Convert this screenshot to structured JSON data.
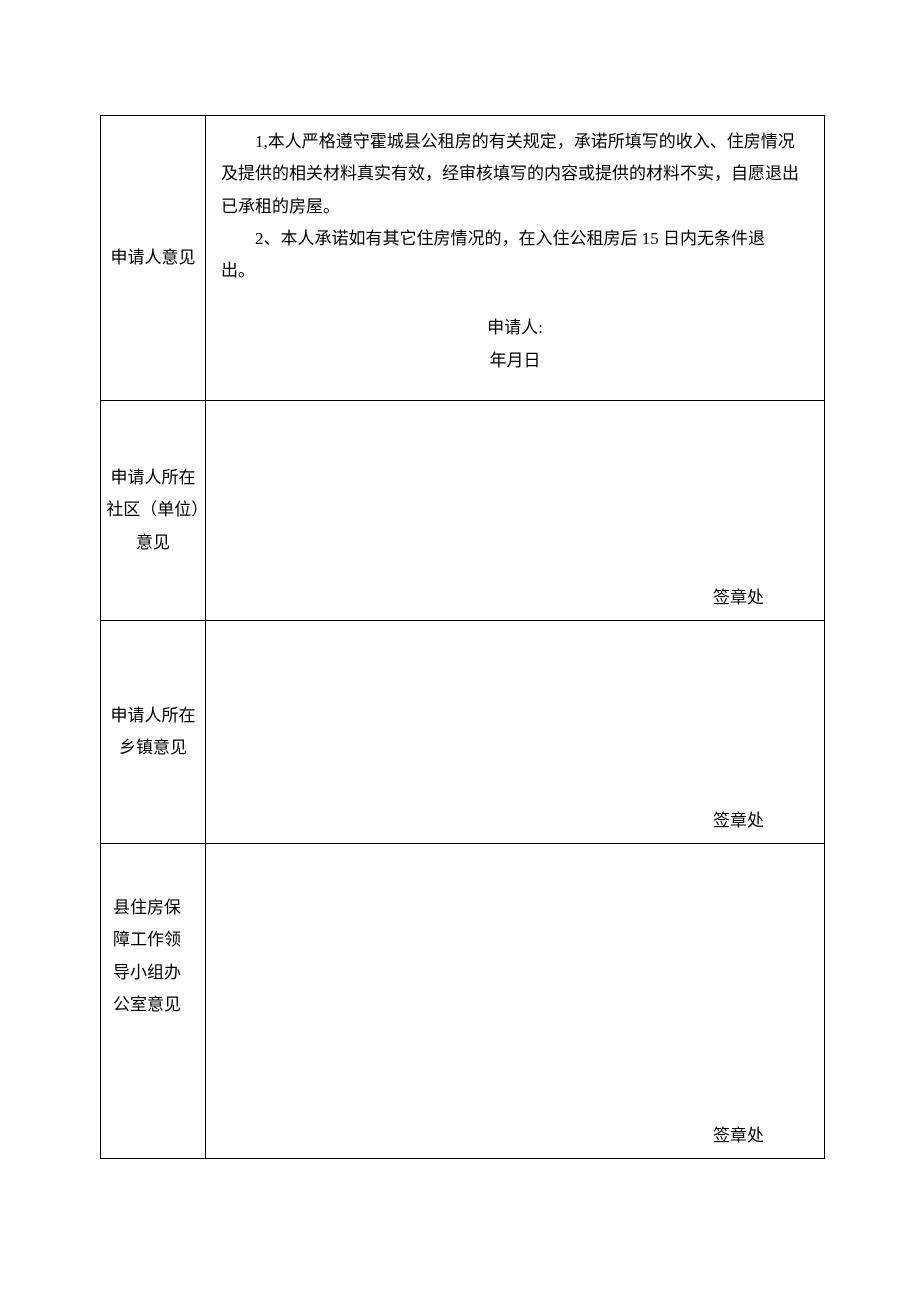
{
  "rows": [
    {
      "label": "申请人意见",
      "statement_line1": "1,本人严格遵守霍城县公租房的有关规定，承诺所填写的收入、住房情况",
      "statement_line2": "及提供的相关材料真实有效，经审核填写的内容或提供的材料不实，自愿退出",
      "statement_line3": "已承租的房屋。",
      "statement_line4": "2、本人承诺如有其它住房情况的，在入住公租房后 15 日内无条件退",
      "statement_line5": "出。",
      "applicant_label": "申请人:",
      "date_label": "年月日"
    },
    {
      "label": "申请人所在社区（单位）意见",
      "seal": "签章处"
    },
    {
      "label": "申请人所在乡镇意见",
      "seal": "签章处"
    },
    {
      "label": "县住房保障工作领导小组办公室意见",
      "seal": "签章处"
    }
  ]
}
